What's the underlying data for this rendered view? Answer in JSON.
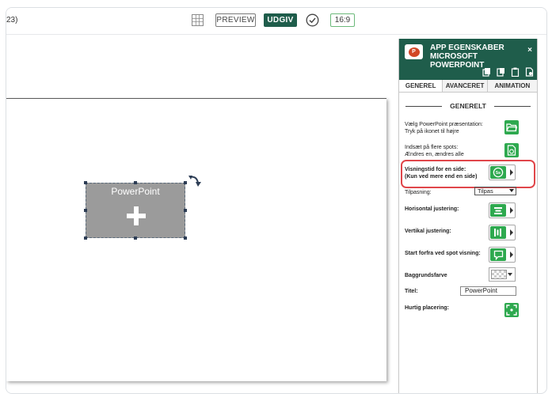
{
  "topbar": {
    "left_title": "23)",
    "preview_label": "PREVIEW",
    "publish_label": "UDGIV",
    "ratio_label": "16:9"
  },
  "canvas": {
    "placeholder_label": "PowerPoint"
  },
  "panel": {
    "title_line1": "APP EGENSKABER",
    "title_line2": "MICROSOFT POWERPOINT",
    "close_label": "×",
    "tabs": [
      "GENEREL",
      "AVANCERET",
      "ANIMATION"
    ],
    "section_title": "GENERELT",
    "rows": {
      "choose_presentation": {
        "line1": "Vælg PowerPoint præsentation:",
        "line2": "Tryk på ikonet til højre"
      },
      "insert_spots": {
        "line1": "Indsæt på flere spots:",
        "line2": "Ændres en, ændres alle"
      },
      "display_time": {
        "line1": "Visningstid for en side:",
        "line2": "(Kun ved mere end en side)"
      },
      "fit": {
        "label": "Tilpasning:",
        "value": "Tilpas"
      },
      "horizontal": {
        "label": "Horisontal justering:"
      },
      "vertical": {
        "label": "Vertikal justering:"
      },
      "start_over": {
        "label": "Start forfra ved spot visning:"
      },
      "background": {
        "label": "Baggrundsfarve"
      },
      "title": {
        "label": "Titel:",
        "value": "PowerPoint"
      },
      "quick_place": {
        "label": "Hurtig placering:"
      }
    },
    "display_time_icon_text": "5s"
  },
  "colors": {
    "brand_dark_green": "#1f5d4b",
    "button_green": "#2ea94f",
    "highlight_red": "#e0464a"
  }
}
